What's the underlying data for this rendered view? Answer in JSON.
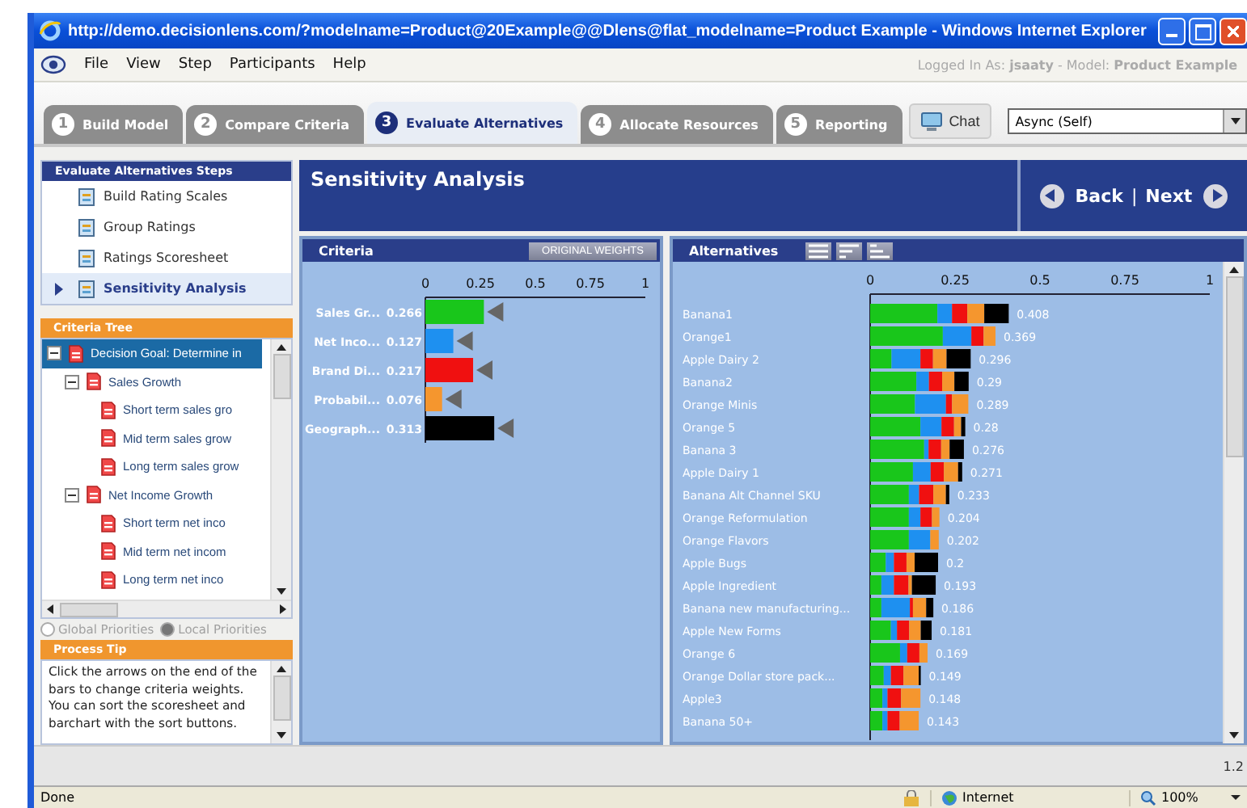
{
  "window": {
    "title": "http://demo.decisionlens.com/?modelname=Product@20Example@@Dlens@flat_modelname=Product Example - Windows Internet Explorer"
  },
  "menu": [
    "File",
    "View",
    "Step",
    "Participants",
    "Help"
  ],
  "login_status": "Logged In As: **jsaaty** - Model: **Product Example**",
  "tabs": [
    {
      "number": "1",
      "label": "Build Model",
      "selected": false
    },
    {
      "number": "2",
      "label": "Compare Criteria",
      "selected": false
    },
    {
      "number": "3",
      "label": "Evaluate Alternatives",
      "selected": true
    },
    {
      "number": "4",
      "label": "Allocate Resources",
      "selected": false
    },
    {
      "number": "5",
      "label": "Reporting",
      "selected": false
    }
  ],
  "chat_button": "Chat",
  "mode_select": {
    "value": "Async (Self)"
  },
  "steps": {
    "title": "Evaluate Alternatives Steps",
    "items": [
      {
        "label": "Build Rating Scales",
        "selected": false
      },
      {
        "label": "Group Ratings",
        "selected": false
      },
      {
        "label": "Ratings Scoresheet",
        "selected": false
      },
      {
        "label": "Sensitivity Analysis",
        "selected": true
      }
    ]
  },
  "criteria_tree": {
    "title": "Criteria Tree",
    "items": [
      {
        "label": "Decision Goal: Determine in",
        "expanded": true,
        "selected": true,
        "children": [
          {
            "label": "Sales Growth",
            "expanded": true,
            "selected": false,
            "children": [
              {
                "label": "Short term sales gro",
                "selected": false
              },
              {
                "label": "Mid term sales grow",
                "selected": false
              },
              {
                "label": "Long term sales grow",
                "selected": false
              }
            ]
          },
          {
            "label": "Net Income Growth",
            "expanded": true,
            "selected": false,
            "children": [
              {
                "label": "Short term net inco",
                "selected": false
              },
              {
                "label": "Mid term net incom",
                "selected": false
              },
              {
                "label": "Long term net inco",
                "selected": false
              }
            ]
          }
        ]
      }
    ]
  },
  "priority_options": [
    {
      "label": "Global Priorities",
      "selected": false,
      "disabled": true
    },
    {
      "label": "Local Priorities",
      "selected": true,
      "disabled": true
    }
  ],
  "process_tip": {
    "title": "Process Tip",
    "text": "Click the arrows on the end of the bars to change criteria weights. You can sort the scoresheet and barchart with the sort buttons."
  },
  "page_title": "Sensitivity Analysis",
  "nav": {
    "back": "Back",
    "separator": "|",
    "next": "Next"
  },
  "criteria_panel": {
    "title": "Criteria",
    "button": "ORIGINAL WEIGHTS",
    "chart_data": {
      "type": "bar",
      "orientation": "horizontal",
      "categories": [
        "Sales Gr...",
        "Net Inco...",
        "Brand Di...",
        "Probabil...",
        "Geograph..."
      ],
      "series": [
        {
          "color": "#19c61b",
          "values": [
            0.266,
            null,
            null,
            null,
            null
          ]
        },
        {
          "color": "#1e90f0",
          "values": [
            null,
            0.127,
            null,
            null,
            null
          ]
        },
        {
          "color": "#f01010",
          "values": [
            null,
            null,
            0.217,
            null,
            null
          ]
        },
        {
          "color": "#f5962e",
          "values": [
            null,
            null,
            null,
            0.076,
            null
          ]
        },
        {
          "color": "#000000",
          "values": [
            null,
            null,
            null,
            null,
            0.313
          ]
        }
      ],
      "value_labels": [
        "0.266",
        "0.127",
        "0.217",
        "0.076",
        "0.313"
      ],
      "xlim": [
        0,
        1
      ],
      "xticks": [
        0,
        0.25,
        0.5,
        0.75,
        1
      ]
    }
  },
  "alternatives_panel": {
    "title": "Alternatives",
    "chart_data": {
      "type": "bar",
      "orientation": "horizontal",
      "stacked": true,
      "categories": [
        "Banana1",
        "Orange1",
        "Apple Dairy 2",
        "Banana2",
        "Orange Minis",
        "Orange 5",
        "Banana 3",
        "Apple Dairy 1",
        "Banana Alt Channel SKU",
        "Orange Reformulation",
        "Orange Flavors",
        "Apple Bugs",
        "Apple Ingredient",
        "Banana new manufacturing...",
        "Apple New  Forms",
        "Orange 6",
        "Orange Dollar store pack...",
        "Apple3",
        "Banana 50+"
      ],
      "series": [
        {
          "color": "#19c61b",
          "values": [
            0.198,
            0.214,
            0.063,
            0.136,
            0.132,
            0.148,
            0.159,
            0.126,
            0.114,
            0.114,
            0.114,
            0.046,
            0.033,
            0.033,
            0.061,
            0.088,
            0.04,
            0.036,
            0.036
          ]
        },
        {
          "color": "#1e90f0",
          "values": [
            0.043,
            0.084,
            0.085,
            0.037,
            0.091,
            0.062,
            0.013,
            0.052,
            0.03,
            0.034,
            0.063,
            0.024,
            0.037,
            0.084,
            0.018,
            0.021,
            0.021,
            0.015,
            0.015
          ]
        },
        {
          "color": "#f01010",
          "values": [
            0.045,
            0.036,
            0.037,
            0.039,
            0.018,
            0.037,
            0.037,
            0.039,
            0.042,
            0.034,
            0,
            0.037,
            0.043,
            0.009,
            0.036,
            0.036,
            0.037,
            0.04,
            0.036
          ]
        },
        {
          "color": "#f5962e",
          "values": [
            0.05,
            0.035,
            0.04,
            0.036,
            0.048,
            0.021,
            0.025,
            0.042,
            0.037,
            0.022,
            0.025,
            0.024,
            0.01,
            0.039,
            0.034,
            0.024,
            0.045,
            0.057,
            0.056
          ]
        },
        {
          "color": "#000000",
          "values": [
            0.072,
            0,
            0.071,
            0.042,
            0,
            0.012,
            0.042,
            0.012,
            0.01,
            0,
            0,
            0.069,
            0.07,
            0.021,
            0.032,
            0,
            0.006,
            0,
            0
          ]
        }
      ],
      "value_labels": [
        "0.408",
        "0.369",
        "0.296",
        "0.29",
        "0.289",
        "0.28",
        "0.276",
        "0.271",
        "0.233",
        "0.204",
        "0.202",
        "0.2",
        "0.193",
        "0.186",
        "0.181",
        "0.169",
        "0.149",
        "0.148",
        "0.143"
      ],
      "xlim": [
        0,
        1
      ],
      "xticks": [
        0,
        0.25,
        0.5,
        0.75,
        1
      ]
    }
  },
  "version": "1.2",
  "status_bar": {
    "text": "Done",
    "zone": "Internet",
    "zoom": "100%"
  }
}
